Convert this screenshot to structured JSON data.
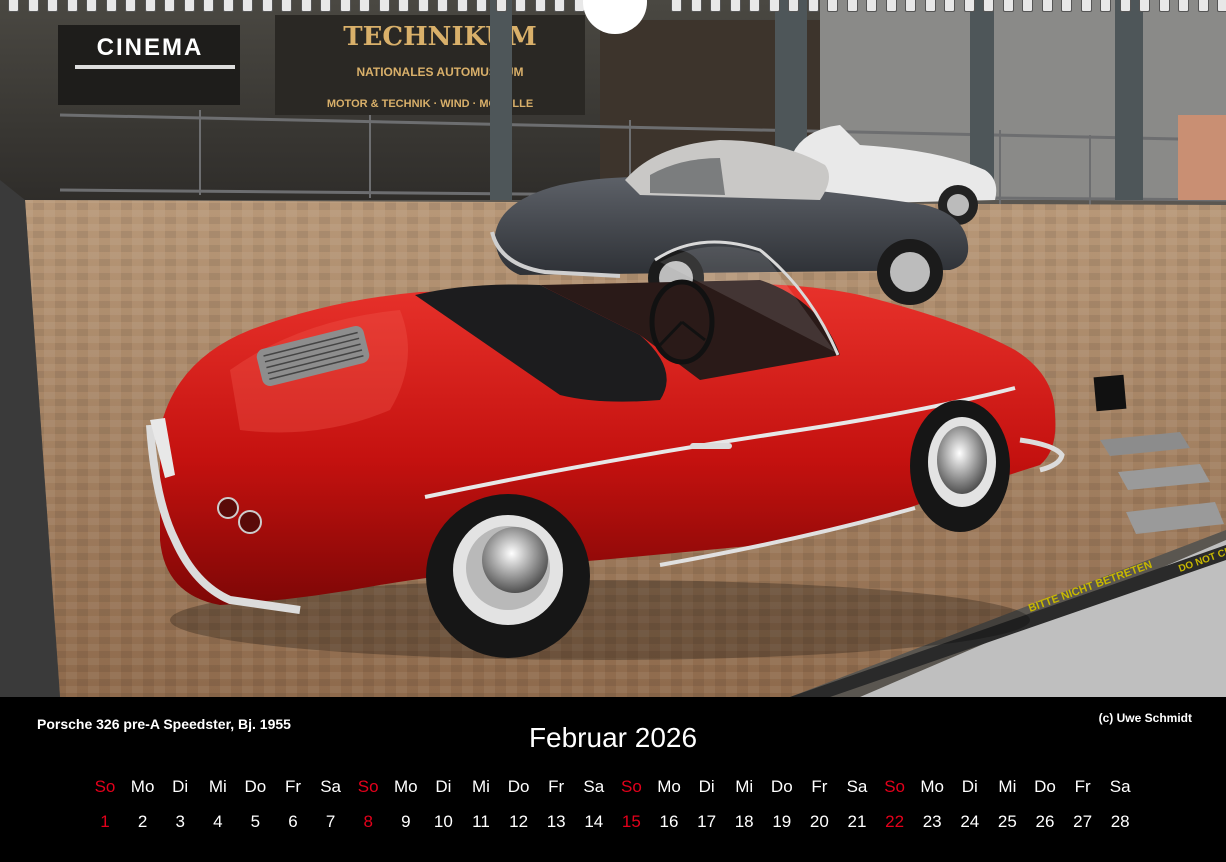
{
  "photo": {
    "caption": "Porsche 326 pre-A Speedster, Bj. 1955",
    "copyright": "(c)  Uwe Schmidt",
    "signs": {
      "cinema": "CINEMA",
      "technikum": "TECHNIKUM",
      "technikum_sub": "NATIONALES AUTOMUSEUM",
      "motor": "MOTOR & TECHNIK · WIND · MODELLE",
      "floor_warning": "BITTE NICHT BETRETEN",
      "floor_warning_en": "DO NOT CROSS"
    }
  },
  "calendar": {
    "month_title": "Februar 2026",
    "weekdays": [
      "So",
      "Mo",
      "Di",
      "Mi",
      "Do",
      "Fr",
      "Sa",
      "So",
      "Mo",
      "Di",
      "Mi",
      "Do",
      "Fr",
      "Sa",
      "So",
      "Mo",
      "Di",
      "Mi",
      "Do",
      "Fr",
      "Sa",
      "So",
      "Mo",
      "Di",
      "Mi",
      "Do",
      "Fr",
      "Sa"
    ],
    "dates": [
      "1",
      "2",
      "3",
      "4",
      "5",
      "6",
      "7",
      "8",
      "9",
      "10",
      "11",
      "12",
      "13",
      "14",
      "15",
      "16",
      "17",
      "18",
      "19",
      "20",
      "21",
      "22",
      "23",
      "24",
      "25",
      "26",
      "27",
      "28"
    ],
    "sunday_indices": [
      0,
      7,
      14,
      21
    ],
    "colors": {
      "sunday": "#e3001b",
      "weekday": "#ffffff",
      "background": "#000000"
    }
  }
}
